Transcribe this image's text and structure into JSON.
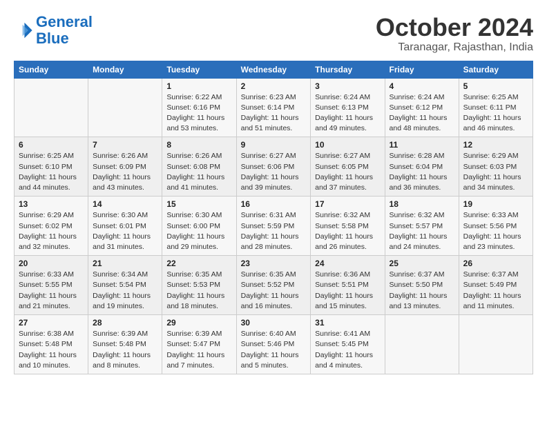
{
  "header": {
    "logo_line1": "General",
    "logo_line2": "Blue",
    "month": "October 2024",
    "location": "Taranagar, Rajasthan, India"
  },
  "days_of_week": [
    "Sunday",
    "Monday",
    "Tuesday",
    "Wednesday",
    "Thursday",
    "Friday",
    "Saturday"
  ],
  "weeks": [
    [
      {
        "day": "",
        "detail": ""
      },
      {
        "day": "",
        "detail": ""
      },
      {
        "day": "1",
        "detail": "Sunrise: 6:22 AM\nSunset: 6:16 PM\nDaylight: 11 hours and 53 minutes."
      },
      {
        "day": "2",
        "detail": "Sunrise: 6:23 AM\nSunset: 6:14 PM\nDaylight: 11 hours and 51 minutes."
      },
      {
        "day": "3",
        "detail": "Sunrise: 6:24 AM\nSunset: 6:13 PM\nDaylight: 11 hours and 49 minutes."
      },
      {
        "day": "4",
        "detail": "Sunrise: 6:24 AM\nSunset: 6:12 PM\nDaylight: 11 hours and 48 minutes."
      },
      {
        "day": "5",
        "detail": "Sunrise: 6:25 AM\nSunset: 6:11 PM\nDaylight: 11 hours and 46 minutes."
      }
    ],
    [
      {
        "day": "6",
        "detail": "Sunrise: 6:25 AM\nSunset: 6:10 PM\nDaylight: 11 hours and 44 minutes."
      },
      {
        "day": "7",
        "detail": "Sunrise: 6:26 AM\nSunset: 6:09 PM\nDaylight: 11 hours and 43 minutes."
      },
      {
        "day": "8",
        "detail": "Sunrise: 6:26 AM\nSunset: 6:08 PM\nDaylight: 11 hours and 41 minutes."
      },
      {
        "day": "9",
        "detail": "Sunrise: 6:27 AM\nSunset: 6:06 PM\nDaylight: 11 hours and 39 minutes."
      },
      {
        "day": "10",
        "detail": "Sunrise: 6:27 AM\nSunset: 6:05 PM\nDaylight: 11 hours and 37 minutes."
      },
      {
        "day": "11",
        "detail": "Sunrise: 6:28 AM\nSunset: 6:04 PM\nDaylight: 11 hours and 36 minutes."
      },
      {
        "day": "12",
        "detail": "Sunrise: 6:29 AM\nSunset: 6:03 PM\nDaylight: 11 hours and 34 minutes."
      }
    ],
    [
      {
        "day": "13",
        "detail": "Sunrise: 6:29 AM\nSunset: 6:02 PM\nDaylight: 11 hours and 32 minutes."
      },
      {
        "day": "14",
        "detail": "Sunrise: 6:30 AM\nSunset: 6:01 PM\nDaylight: 11 hours and 31 minutes."
      },
      {
        "day": "15",
        "detail": "Sunrise: 6:30 AM\nSunset: 6:00 PM\nDaylight: 11 hours and 29 minutes."
      },
      {
        "day": "16",
        "detail": "Sunrise: 6:31 AM\nSunset: 5:59 PM\nDaylight: 11 hours and 28 minutes."
      },
      {
        "day": "17",
        "detail": "Sunrise: 6:32 AM\nSunset: 5:58 PM\nDaylight: 11 hours and 26 minutes."
      },
      {
        "day": "18",
        "detail": "Sunrise: 6:32 AM\nSunset: 5:57 PM\nDaylight: 11 hours and 24 minutes."
      },
      {
        "day": "19",
        "detail": "Sunrise: 6:33 AM\nSunset: 5:56 PM\nDaylight: 11 hours and 23 minutes."
      }
    ],
    [
      {
        "day": "20",
        "detail": "Sunrise: 6:33 AM\nSunset: 5:55 PM\nDaylight: 11 hours and 21 minutes."
      },
      {
        "day": "21",
        "detail": "Sunrise: 6:34 AM\nSunset: 5:54 PM\nDaylight: 11 hours and 19 minutes."
      },
      {
        "day": "22",
        "detail": "Sunrise: 6:35 AM\nSunset: 5:53 PM\nDaylight: 11 hours and 18 minutes."
      },
      {
        "day": "23",
        "detail": "Sunrise: 6:35 AM\nSunset: 5:52 PM\nDaylight: 11 hours and 16 minutes."
      },
      {
        "day": "24",
        "detail": "Sunrise: 6:36 AM\nSunset: 5:51 PM\nDaylight: 11 hours and 15 minutes."
      },
      {
        "day": "25",
        "detail": "Sunrise: 6:37 AM\nSunset: 5:50 PM\nDaylight: 11 hours and 13 minutes."
      },
      {
        "day": "26",
        "detail": "Sunrise: 6:37 AM\nSunset: 5:49 PM\nDaylight: 11 hours and 11 minutes."
      }
    ],
    [
      {
        "day": "27",
        "detail": "Sunrise: 6:38 AM\nSunset: 5:48 PM\nDaylight: 11 hours and 10 minutes."
      },
      {
        "day": "28",
        "detail": "Sunrise: 6:39 AM\nSunset: 5:48 PM\nDaylight: 11 hours and 8 minutes."
      },
      {
        "day": "29",
        "detail": "Sunrise: 6:39 AM\nSunset: 5:47 PM\nDaylight: 11 hours and 7 minutes."
      },
      {
        "day": "30",
        "detail": "Sunrise: 6:40 AM\nSunset: 5:46 PM\nDaylight: 11 hours and 5 minutes."
      },
      {
        "day": "31",
        "detail": "Sunrise: 6:41 AM\nSunset: 5:45 PM\nDaylight: 11 hours and 4 minutes."
      },
      {
        "day": "",
        "detail": ""
      },
      {
        "day": "",
        "detail": ""
      }
    ]
  ]
}
